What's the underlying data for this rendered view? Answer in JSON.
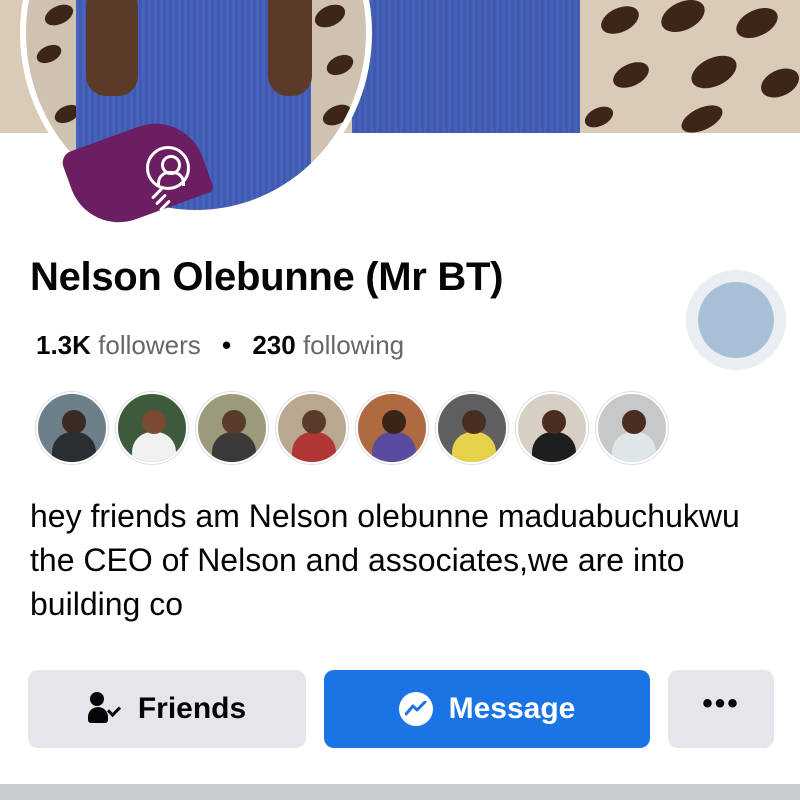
{
  "profile": {
    "name": "Nelson Olebunne (Mr BT)",
    "followers_count": "1.3K",
    "followers_label": "followers",
    "separator": "•",
    "following_count": "230",
    "following_label": "following",
    "bio": "hey friends am Nelson olebunne maduabuchukwu the CEO of Nelson and associates,we are into building co"
  },
  "friends_preview": [
    {
      "name": "friend-1",
      "bg": "#6d7f88",
      "skin": "#3b2a22",
      "cloth": "#2a2e33"
    },
    {
      "name": "friend-2",
      "bg": "#3e5a3c",
      "skin": "#7a4a32",
      "cloth": "#f0f0f0"
    },
    {
      "name": "friend-3",
      "bg": "#9b9a7a",
      "skin": "#5a3a2a",
      "cloth": "#3a3a3a"
    },
    {
      "name": "friend-4",
      "bg": "#b8a890",
      "skin": "#5a3a2a",
      "cloth": "#b13636"
    },
    {
      "name": "friend-5",
      "bg": "#b06a40",
      "skin": "#3a2419",
      "cloth": "#5a4aa0"
    },
    {
      "name": "friend-6",
      "bg": "#5f5f5f",
      "skin": "#4a2d20",
      "cloth": "#e6d24a"
    },
    {
      "name": "friend-7",
      "bg": "#d8cfc4",
      "skin": "#4a2d20",
      "cloth": "#1e1e1e"
    },
    {
      "name": "friend-8",
      "bg": "#c7c9c9",
      "skin": "#4a2d20",
      "cloth": "#dfe6e8"
    }
  ],
  "actions": {
    "friends_label": "Friends",
    "message_label": "Message",
    "more_label": "•••"
  },
  "colors": {
    "primary": "#1b74e4",
    "secondary_button": "#e4e6eb",
    "muted_text": "#65676b",
    "badge": "#6b1f62"
  }
}
